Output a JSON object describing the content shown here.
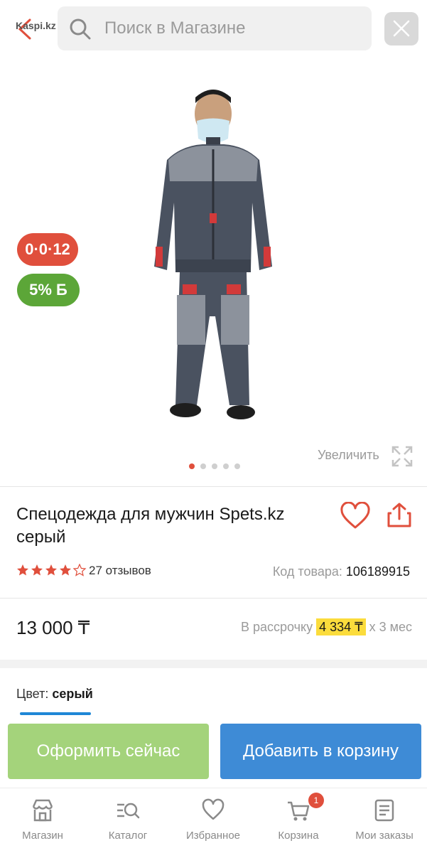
{
  "header": {
    "watermark": "Kaspi.kz",
    "search_placeholder": "Поиск в Магазине"
  },
  "gallery": {
    "installment_badge": "0·0·12",
    "bonus_badge": "5%",
    "bonus_badge_suffix": "Б",
    "zoom_label": "Увеличить",
    "slide_count": 5,
    "active_slide": 1
  },
  "product": {
    "title": "Спецодежда для мужчин Spets.kz серый",
    "rating": 4.5,
    "reviews_label": "27 отзывов",
    "sku_label": "Код товара:",
    "sku_value": "106189915"
  },
  "pricing": {
    "price": "13 000 ₸",
    "credit_prefix": "В рассрочку",
    "credit_amount": "4 334 ₸",
    "credit_suffix": "х 3 мес"
  },
  "options": {
    "color_label": "Цвет:",
    "color_value": "серый"
  },
  "actions": {
    "buy_now": "Оформить сейчас",
    "add_to_cart": "Добавить в корзину"
  },
  "nav": {
    "items": [
      {
        "label": "Магазин",
        "icon": "shop-icon"
      },
      {
        "label": "Каталог",
        "icon": "catalog-icon"
      },
      {
        "label": "Избранное",
        "icon": "heart-icon"
      },
      {
        "label": "Корзина",
        "icon": "cart-icon",
        "badge": "1"
      },
      {
        "label": "Мои заказы",
        "icon": "orders-icon"
      }
    ]
  },
  "colors": {
    "accent_red": "#e04f3c",
    "bonus_green": "#5ca638",
    "buy_green": "#a4d37b",
    "cart_blue": "#3e8bd6",
    "credit_yellow": "#fbdc3c"
  }
}
